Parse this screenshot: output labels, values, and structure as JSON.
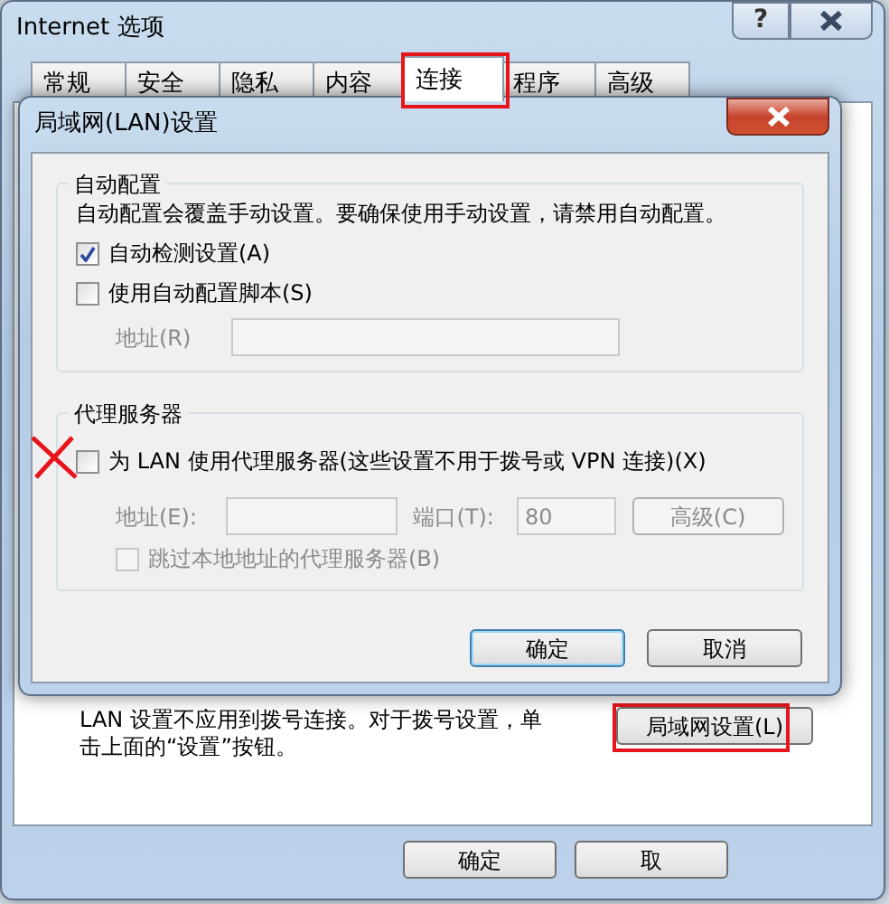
{
  "main_window": {
    "title": "Internet 选项",
    "help_button": "?",
    "tabs": [
      {
        "label": "常规",
        "selected": false,
        "highlighted": false
      },
      {
        "label": "安全",
        "selected": false,
        "highlighted": false
      },
      {
        "label": "隐私",
        "selected": false,
        "highlighted": false
      },
      {
        "label": "内容",
        "selected": false,
        "highlighted": false
      },
      {
        "label": "连接",
        "selected": true,
        "highlighted": true
      },
      {
        "label": "程序",
        "selected": false,
        "highlighted": false
      },
      {
        "label": "高级",
        "selected": false,
        "highlighted": false
      }
    ],
    "note": "LAN 设置不应用到拨号连接。对于拨号设置，单击上面的“设置”按钮。",
    "lan_button": {
      "label": "局域网设置(L)",
      "highlighted": true
    },
    "buttons": [
      "确定",
      "取"
    ]
  },
  "lan_dialog": {
    "title": "局域网(LAN)设置",
    "auto_config": {
      "heading": "自动配置",
      "description": "自动配置会覆盖手动设置。要确保使用手动设置，请禁用自动配置。",
      "options": [
        {
          "label": "自动检测设置(A)",
          "checked": true
        },
        {
          "label": "使用自动配置脚本(S)",
          "checked": false
        }
      ],
      "address": {
        "label": "地址(R)",
        "disabled": true
      }
    },
    "proxy": {
      "heading": "代理服务器",
      "enable": {
        "label": "为 LAN 使用代理服务器(这些设置不用于拨号或 VPN 连接)(X)",
        "checked": false,
        "crossed": true
      },
      "disabled": true,
      "address_label": "地址(E):",
      "port_label": "端口(T):",
      "port_value": "80",
      "advanced_button": "高级(C)",
      "bypass": {
        "label": "跳过本地地址的代理服务器(B)",
        "checked": false
      }
    },
    "buttons": [
      {
        "label": "确定",
        "default": true
      },
      {
        "label": "取消",
        "default": false
      }
    ]
  }
}
